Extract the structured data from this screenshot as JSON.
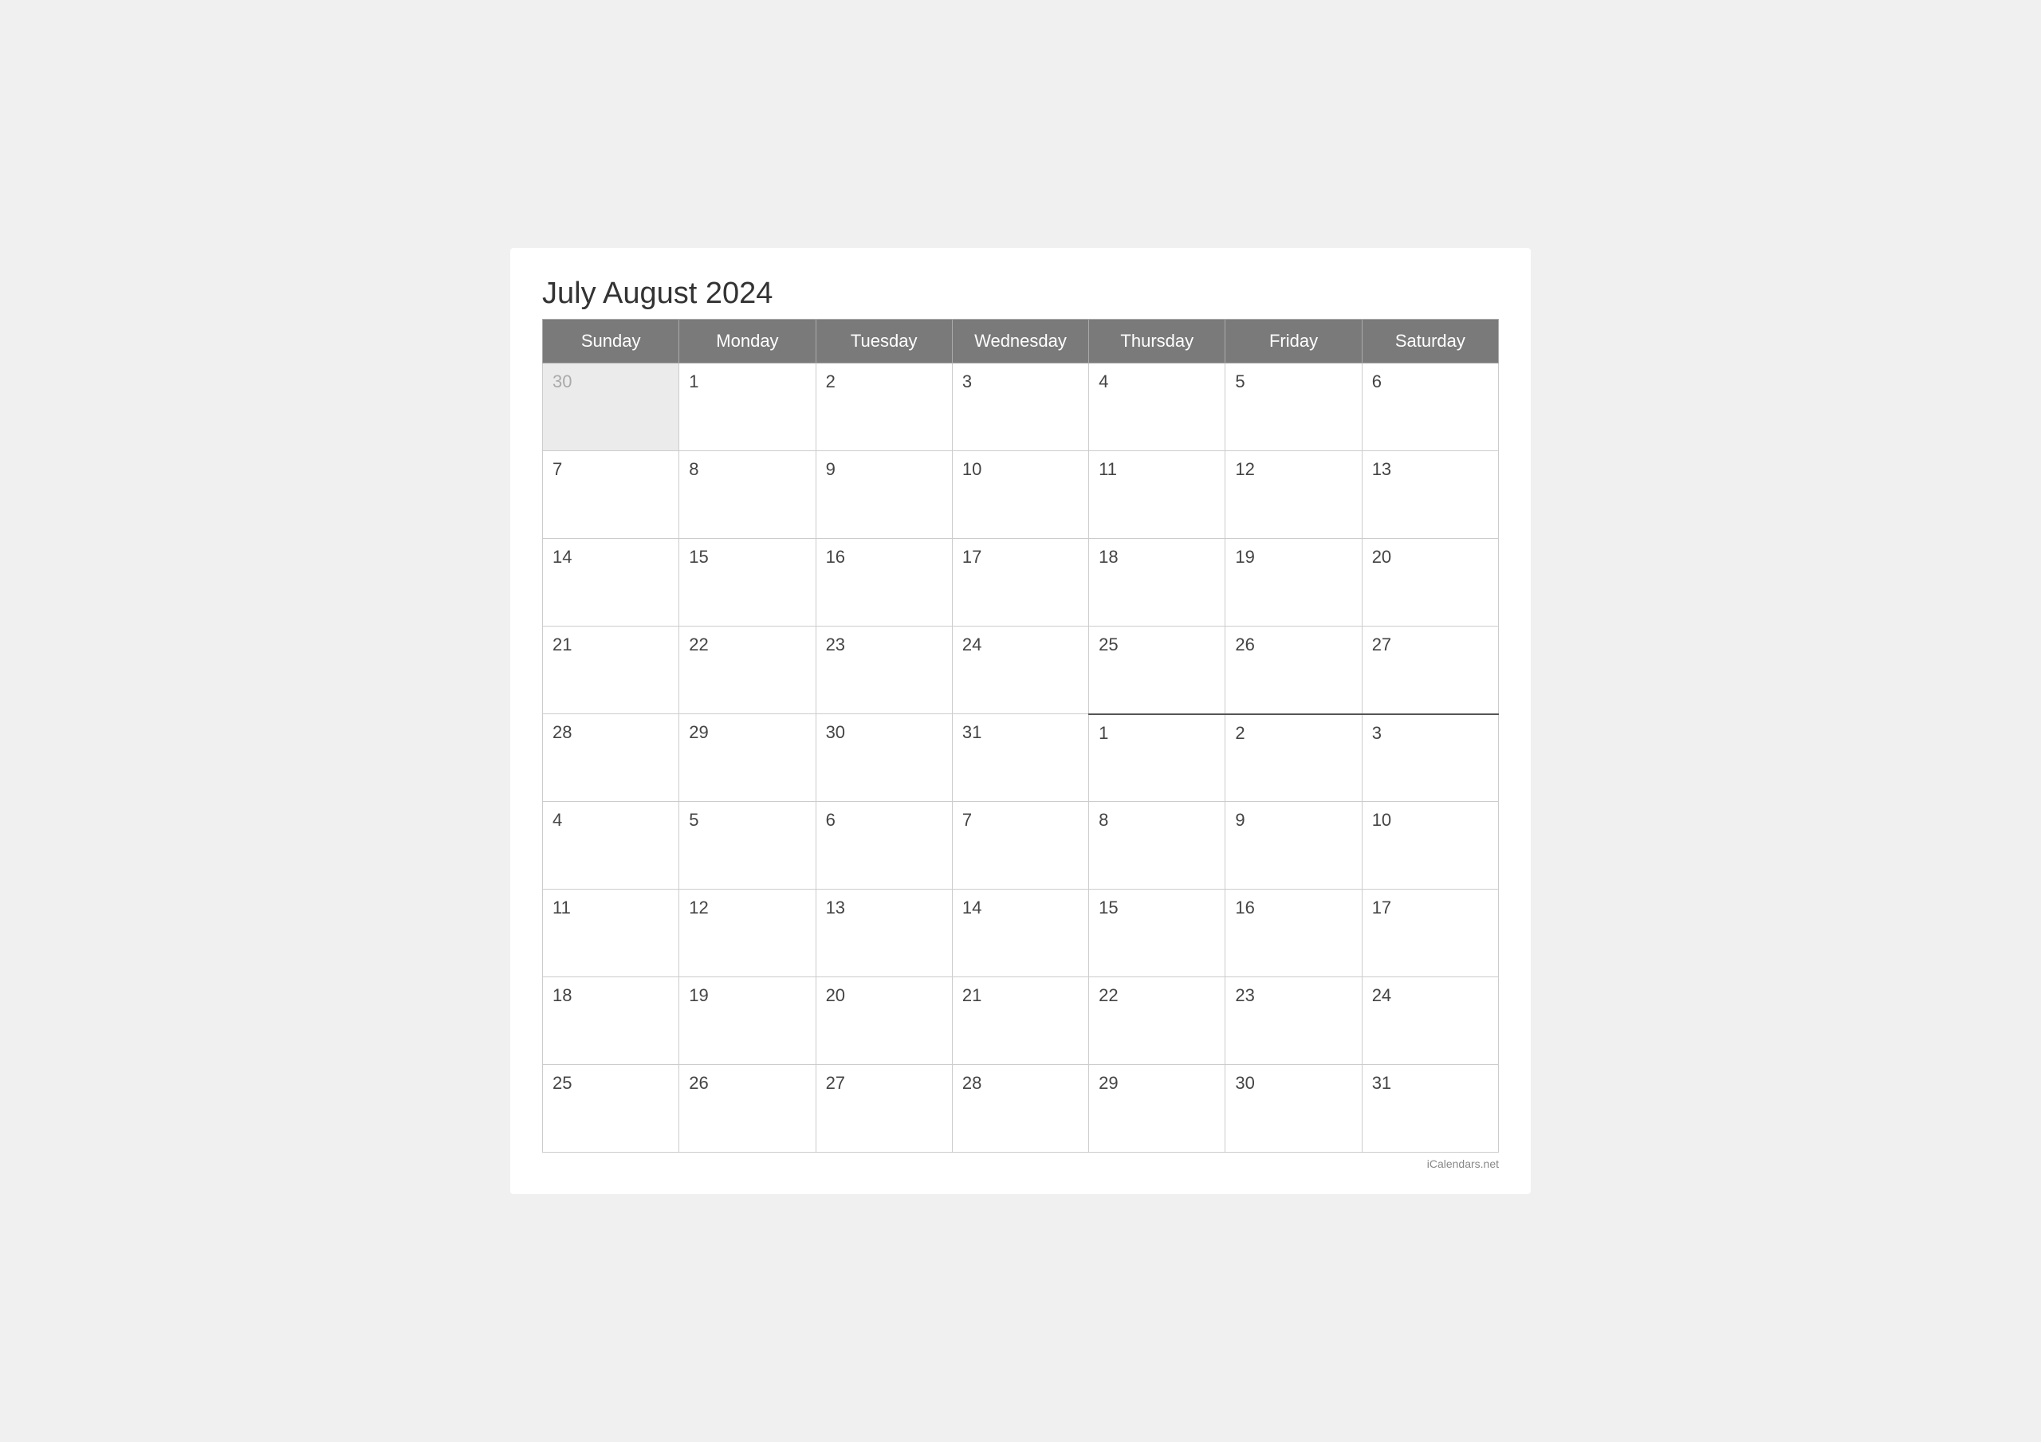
{
  "title": "July August 2024",
  "watermark": "iCalendars.net",
  "headers": [
    "Sunday",
    "Monday",
    "Tuesday",
    "Wednesday",
    "Thursday",
    "Friday",
    "Saturday"
  ],
  "rows": [
    [
      {
        "day": "30",
        "outside": true,
        "boundaryTop": false
      },
      {
        "day": "1",
        "outside": false,
        "boundaryTop": false
      },
      {
        "day": "2",
        "outside": false,
        "boundaryTop": false
      },
      {
        "day": "3",
        "outside": false,
        "boundaryTop": false
      },
      {
        "day": "4",
        "outside": false,
        "boundaryTop": false
      },
      {
        "day": "5",
        "outside": false,
        "boundaryTop": false
      },
      {
        "day": "6",
        "outside": false,
        "boundaryTop": false
      }
    ],
    [
      {
        "day": "7",
        "outside": false,
        "boundaryTop": false
      },
      {
        "day": "8",
        "outside": false,
        "boundaryTop": false
      },
      {
        "day": "9",
        "outside": false,
        "boundaryTop": false
      },
      {
        "day": "10",
        "outside": false,
        "boundaryTop": false
      },
      {
        "day": "11",
        "outside": false,
        "boundaryTop": false
      },
      {
        "day": "12",
        "outside": false,
        "boundaryTop": false
      },
      {
        "day": "13",
        "outside": false,
        "boundaryTop": false
      }
    ],
    [
      {
        "day": "14",
        "outside": false,
        "boundaryTop": false
      },
      {
        "day": "15",
        "outside": false,
        "boundaryTop": false
      },
      {
        "day": "16",
        "outside": false,
        "boundaryTop": false
      },
      {
        "day": "17",
        "outside": false,
        "boundaryTop": false
      },
      {
        "day": "18",
        "outside": false,
        "boundaryTop": false
      },
      {
        "day": "19",
        "outside": false,
        "boundaryTop": false
      },
      {
        "day": "20",
        "outside": false,
        "boundaryTop": false
      }
    ],
    [
      {
        "day": "21",
        "outside": false,
        "boundaryTop": false
      },
      {
        "day": "22",
        "outside": false,
        "boundaryTop": false
      },
      {
        "day": "23",
        "outside": false,
        "boundaryTop": false
      },
      {
        "day": "24",
        "outside": false,
        "boundaryTop": false
      },
      {
        "day": "25",
        "outside": false,
        "boundaryTop": false
      },
      {
        "day": "26",
        "outside": false,
        "boundaryTop": false
      },
      {
        "day": "27",
        "outside": false,
        "boundaryTop": false
      }
    ],
    [
      {
        "day": "28",
        "outside": false,
        "boundaryTop": false
      },
      {
        "day": "29",
        "outside": false,
        "boundaryTop": false
      },
      {
        "day": "30",
        "outside": false,
        "boundaryTop": false
      },
      {
        "day": "31",
        "outside": false,
        "boundaryTop": false
      },
      {
        "day": "1",
        "outside": false,
        "boundaryTop": true
      },
      {
        "day": "2",
        "outside": false,
        "boundaryTop": true
      },
      {
        "day": "3",
        "outside": false,
        "boundaryTop": true
      }
    ],
    [
      {
        "day": "4",
        "outside": false,
        "boundaryTop": false
      },
      {
        "day": "5",
        "outside": false,
        "boundaryTop": false
      },
      {
        "day": "6",
        "outside": false,
        "boundaryTop": false
      },
      {
        "day": "7",
        "outside": false,
        "boundaryTop": false
      },
      {
        "day": "8",
        "outside": false,
        "boundaryTop": false
      },
      {
        "day": "9",
        "outside": false,
        "boundaryTop": false
      },
      {
        "day": "10",
        "outside": false,
        "boundaryTop": false
      }
    ],
    [
      {
        "day": "11",
        "outside": false,
        "boundaryTop": false
      },
      {
        "day": "12",
        "outside": false,
        "boundaryTop": false
      },
      {
        "day": "13",
        "outside": false,
        "boundaryTop": false
      },
      {
        "day": "14",
        "outside": false,
        "boundaryTop": false
      },
      {
        "day": "15",
        "outside": false,
        "boundaryTop": false
      },
      {
        "day": "16",
        "outside": false,
        "boundaryTop": false
      },
      {
        "day": "17",
        "outside": false,
        "boundaryTop": false
      }
    ],
    [
      {
        "day": "18",
        "outside": false,
        "boundaryTop": false
      },
      {
        "day": "19",
        "outside": false,
        "boundaryTop": false
      },
      {
        "day": "20",
        "outside": false,
        "boundaryTop": false
      },
      {
        "day": "21",
        "outside": false,
        "boundaryTop": false
      },
      {
        "day": "22",
        "outside": false,
        "boundaryTop": false
      },
      {
        "day": "23",
        "outside": false,
        "boundaryTop": false
      },
      {
        "day": "24",
        "outside": false,
        "boundaryTop": false
      }
    ],
    [
      {
        "day": "25",
        "outside": false,
        "boundaryTop": false
      },
      {
        "day": "26",
        "outside": false,
        "boundaryTop": false
      },
      {
        "day": "27",
        "outside": false,
        "boundaryTop": false
      },
      {
        "day": "28",
        "outside": false,
        "boundaryTop": false
      },
      {
        "day": "29",
        "outside": false,
        "boundaryTop": false
      },
      {
        "day": "30",
        "outside": false,
        "boundaryTop": false
      },
      {
        "day": "31",
        "outside": false,
        "boundaryTop": false
      }
    ]
  ]
}
